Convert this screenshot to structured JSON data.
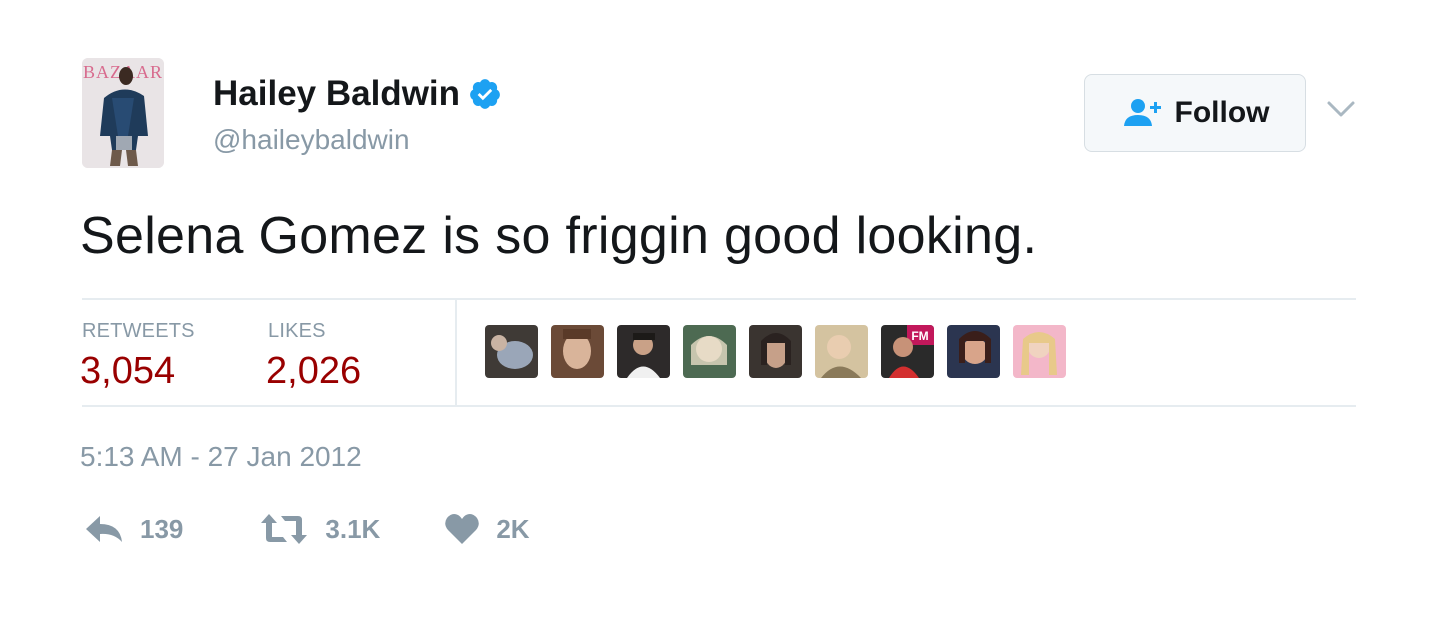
{
  "user": {
    "name": "Hailey Baldwin",
    "handle": "@haileybaldwin",
    "avatar_icon": "magazine-cover-avatar",
    "avatar_text": "BAZAAR"
  },
  "follow": {
    "label": "Follow",
    "icon": "add-user-icon"
  },
  "tweet": {
    "text": "Selena Gomez is so friggin good looking."
  },
  "stats": {
    "retweets_label": "RETWEETS",
    "retweets_value": "3,054",
    "likes_label": "LIKES",
    "likes_value": "2,026"
  },
  "likers": [
    {
      "icon": "liker-avatar"
    },
    {
      "icon": "liker-avatar"
    },
    {
      "icon": "liker-avatar"
    },
    {
      "icon": "liker-avatar"
    },
    {
      "icon": "liker-avatar"
    },
    {
      "icon": "liker-avatar"
    },
    {
      "icon": "liker-avatar"
    },
    {
      "icon": "liker-avatar"
    },
    {
      "icon": "liker-avatar"
    }
  ],
  "timestamp": "5:13 AM - 27 Jan 2012",
  "actions": {
    "reply_count": "139",
    "retweet_count": "3.1K",
    "like_count": "2K"
  },
  "colors": {
    "stat_value": "#990000",
    "muted": "#8899a6",
    "verified": "#1da1f2",
    "follow_icon": "#1da1f2"
  }
}
